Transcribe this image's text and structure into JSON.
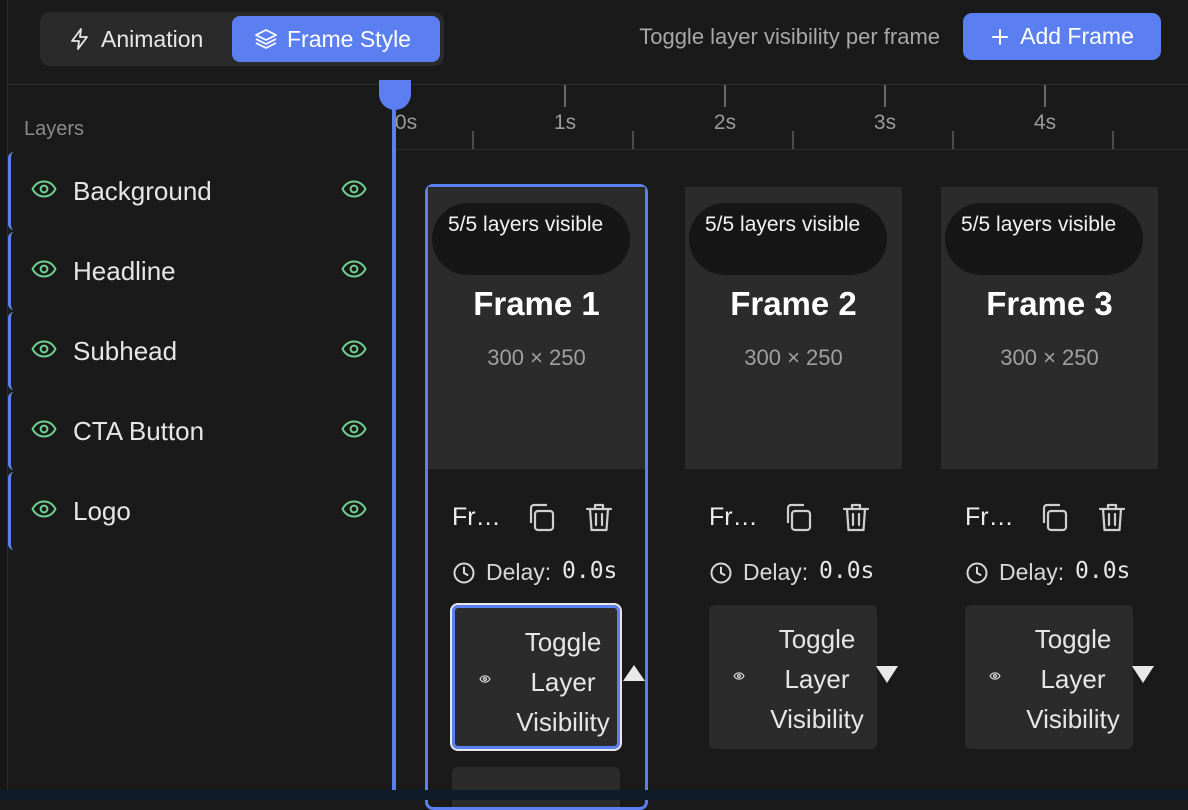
{
  "toolbar": {
    "tabs": [
      {
        "label": "Animation",
        "icon": "lightning-icon",
        "active": false
      },
      {
        "label": "Frame Style",
        "icon": "layers-icon",
        "active": true
      }
    ],
    "hint": "Toggle layer visibility per frame",
    "add_frame_label": "Add Frame"
  },
  "timeline": {
    "layers_header": "Layers",
    "ticks": [
      "0s",
      "1s",
      "2s",
      "3s",
      "4s"
    ],
    "playhead_time": "0s"
  },
  "layers": [
    {
      "name": "Background",
      "visible": true
    },
    {
      "name": "Headline",
      "visible": true
    },
    {
      "name": "Subhead",
      "visible": true
    },
    {
      "name": "CTA Button",
      "visible": true
    },
    {
      "name": "Logo",
      "visible": true
    }
  ],
  "frames": [
    {
      "title": "Frame 1",
      "size": "300 × 250",
      "badge": "5/5 layers visible",
      "name_truncated": "Fr…",
      "delay_label": "Delay:",
      "delay_value": "0.0s",
      "toggle_label": "Toggle Layer Visibility",
      "expanded": true,
      "selected": true
    },
    {
      "title": "Frame 2",
      "size": "300 × 250",
      "badge": "5/5 layers visible",
      "name_truncated": "Fr…",
      "delay_label": "Delay:",
      "delay_value": "0.0s",
      "toggle_label": "Toggle Layer Visibility",
      "expanded": false,
      "selected": false
    },
    {
      "title": "Frame 3",
      "size": "300 × 250",
      "badge": "5/5 layers visible",
      "name_truncated": "Fr…",
      "delay_label": "Delay:",
      "delay_value": "0.0s",
      "toggle_label": "Toggle Layer Visibility",
      "expanded": false,
      "selected": false
    }
  ],
  "colors": {
    "accent": "#5b7ff0",
    "eye_green": "#6fcf8f",
    "background": "#1a1a1a",
    "card": "#2b2b2b"
  }
}
